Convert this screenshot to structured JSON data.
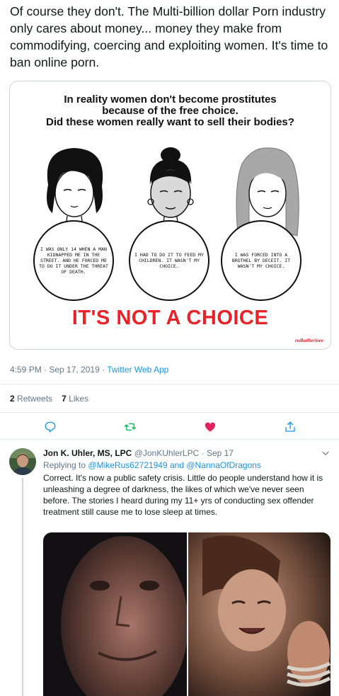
{
  "tweet": {
    "text": "Of course they don't. The Multi-billion dollar Porn industry only cares about money... money they make from commodifying, coercing and exploiting women. It's time to ban online porn.",
    "card": {
      "heading_line1": "In reality women don't become prostitutes",
      "heading_line2": "because of the free choice.",
      "heading_line3": "Did these women really want to sell their bodies?",
      "bubbles": [
        "I was only 14 when a man kidnapped me in the street. And he forced me to do it under the threat of death.",
        "I had to do it to feed my children. It wasn't my choice.",
        "I was forced into a brothel by deceit. It wasn't my choice."
      ],
      "slogan": "IT'S NOT A CHOICE",
      "signature": "redkatherinee"
    },
    "time": "4:59 PM · Sep 17, 2019",
    "separator": " · ",
    "source": "Twitter Web App",
    "retweets_count": "2",
    "retweets_label": "Retweets",
    "likes_count": "7",
    "likes_label": "Likes",
    "actions": [
      {
        "icon": "reply-icon",
        "color": "#1b95e0"
      },
      {
        "icon": "retweet-icon",
        "color": "#17bf63"
      },
      {
        "icon": "heart-icon",
        "color": "#e0245e"
      },
      {
        "icon": "share-icon",
        "color": "#1b95e0"
      }
    ]
  },
  "reply": {
    "name": "Jon K. Uhler, MS, LPC",
    "handle": "@JonKUhlerLPC",
    "date": "· Sep 17",
    "replying_label": "Replying to",
    "replying_handle_1": "@MikeRus62721949",
    "replying_and": "and",
    "replying_handle_2": "@NannaOfDragons",
    "text": "Correct. It's now a public safety crisis. Little do people understand how it is unleashing a degree of darkness, the likes of which we've never seen before. The stories I heard during my 11+ yrs of conducting sex offender treatment still cause me to lose sleep at times."
  }
}
